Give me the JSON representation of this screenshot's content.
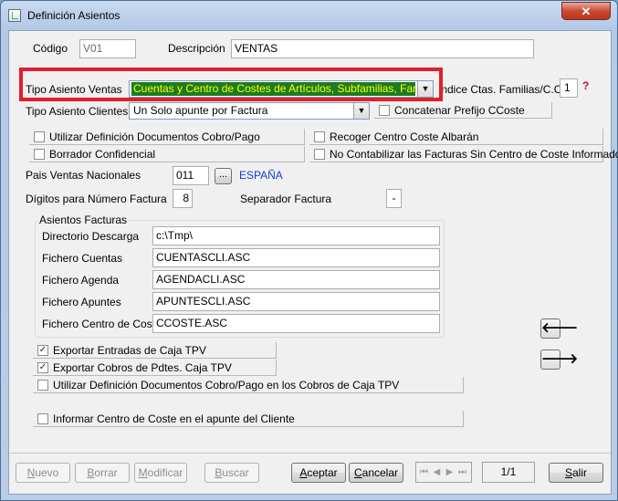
{
  "window": {
    "title": "Definición Asientos",
    "close_glyph": "✕"
  },
  "fields": {
    "codigo_label": "Código",
    "codigo_value": "V01",
    "descripcion_label": "Descripción",
    "descripcion_value": "VENTAS",
    "tipo_ventas_label": "Tipo Asiento Ventas",
    "tipo_ventas_value": "Cuentas y Centro de Costes de Artículos, Subfamilias, Familias",
    "indice_label": "Indice Ctas. Familias/C.Cost",
    "indice_value": "1",
    "tipo_clientes_label": "Tipo Asiento Clientes",
    "tipo_clientes_value": "Un Solo apunte por Factura",
    "concatenar_label": "Concatenar Prefijo CCoste",
    "pais_label": "Pais Ventas Nacionales",
    "pais_value": "011",
    "pais_browse": "...",
    "pais_name": "ESPAÑA",
    "digitos_label": "Dígitos para Número Factura",
    "digitos_value": "8",
    "separador_label": "Separador Factura",
    "separador_value": "-"
  },
  "checks": {
    "utilizar_def": {
      "label": "Utilizar Definición Documentos Cobro/Pago",
      "checked": false
    },
    "borrador": {
      "label": "Borrador Confidencial",
      "checked": false
    },
    "recoger_cc": {
      "label": "Recoger Centro Coste Albarán",
      "checked": false
    },
    "no_contab": {
      "label": "No Contabilizar las Facturas Sin Centro de Coste Informado",
      "checked": false
    },
    "exp_entradas": {
      "label": "Exportar Entradas de Caja TPV",
      "checked": true
    },
    "exp_cobros": {
      "label": "Exportar Cobros de Pdtes. Caja TPV",
      "checked": true
    },
    "util_def_tpv": {
      "label": "Utilizar Definición Documentos Cobro/Pago en los Cobros de Caja TPV",
      "checked": false
    },
    "informar_cc": {
      "label": "Informar Centro de Coste en el apunte del Cliente",
      "checked": false
    }
  },
  "asientos": {
    "group_title": "Asientos Facturas",
    "rows": [
      {
        "label": "Directorio Descarga",
        "value": "c:\\Tmp\\"
      },
      {
        "label": "Fichero Cuentas",
        "value": "CUENTASCLI.ASC"
      },
      {
        "label": "Fichero Agenda",
        "value": "AGENDACLI.ASC"
      },
      {
        "label": "Fichero Apuntes",
        "value": "APUNTESCLI.ASC"
      },
      {
        "label": "Fichero Centro de Coste",
        "value": "CCOSTE.ASC"
      }
    ]
  },
  "buttons": {
    "nuevo_u": "N",
    "nuevo_rest": "uevo",
    "borrar_u": "B",
    "borrar_rest": "orrar",
    "modificar_u": "M",
    "modificar_rest": "odificar",
    "buscar_u": "B",
    "buscar_rest": "uscar",
    "aceptar_u": "A",
    "aceptar_rest": "ceptar",
    "cancelar_u": "C",
    "cancelar_rest": "ancelar",
    "salir_u": "S",
    "salir_rest": "alir",
    "page": "1/1"
  },
  "icons": {
    "prev_arrow": "🡐",
    "next_arrow": "🡒",
    "help": "?"
  },
  "colors": {
    "highlight": "#e0202a",
    "selected_bg": "#1c7c22",
    "selected_fg": "#ffff00",
    "link_blue": "#1a3acb"
  }
}
